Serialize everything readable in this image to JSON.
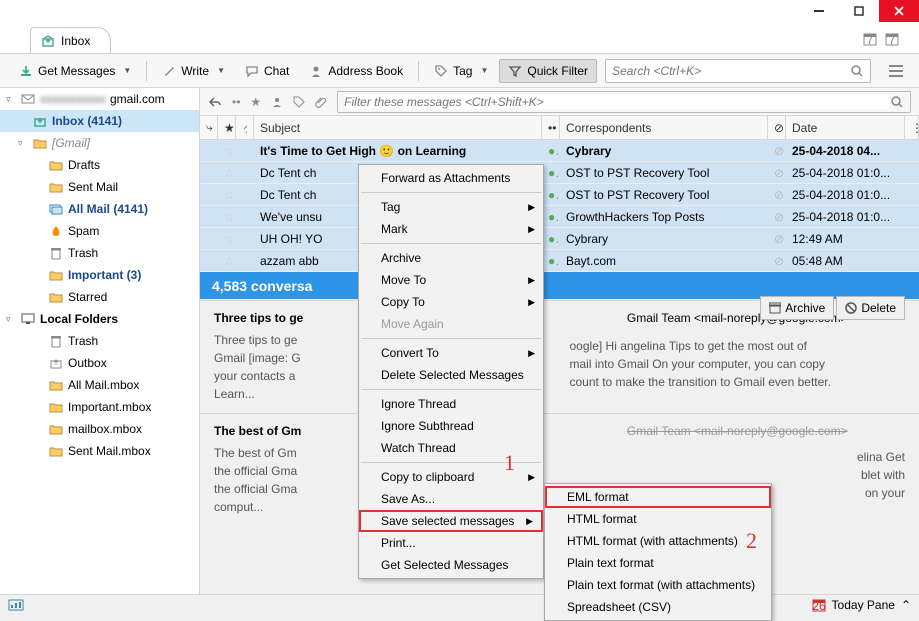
{
  "window": {
    "tab_label": "Inbox"
  },
  "toolbar": {
    "get_messages": "Get Messages",
    "write": "Write",
    "chat": "Chat",
    "address_book": "Address Book",
    "tag": "Tag",
    "quick_filter": "Quick Filter",
    "search_placeholder": "Search <Ctrl+K>"
  },
  "sidebar": {
    "account": "gmail.com",
    "items": [
      {
        "label": "Inbox (4141)",
        "bold": true
      },
      {
        "label": "[Gmail]",
        "gray": true
      },
      {
        "label": "Drafts"
      },
      {
        "label": "Sent Mail"
      },
      {
        "label": "All Mail (4141)",
        "bold": true
      },
      {
        "label": "Spam"
      },
      {
        "label": "Trash"
      },
      {
        "label": "Important (3)",
        "bold": true
      },
      {
        "label": "Starred"
      }
    ],
    "local_header": "Local Folders",
    "local": [
      {
        "label": "Trash"
      },
      {
        "label": "Outbox"
      },
      {
        "label": "All Mail.mbox"
      },
      {
        "label": "Important.mbox"
      },
      {
        "label": "mailbox.mbox"
      },
      {
        "label": "Sent Mail.mbox"
      }
    ]
  },
  "filter": {
    "placeholder": "Filter these messages <Ctrl+Shift+K>"
  },
  "columns": {
    "subject": "Subject",
    "correspondents": "Correspondents",
    "date": "Date"
  },
  "messages": [
    {
      "subject": "It's Time to Get High 🙂 on Learning",
      "from": "Cybrary",
      "date": "25-04-2018 04...",
      "bold": true
    },
    {
      "subject": "Dc Tent ch",
      "from": "OST to PST Recovery Tool",
      "date": "25-04-2018 01:0..."
    },
    {
      "subject": "Dc Tent ch",
      "from": "OST to PST Recovery Tool",
      "date": "25-04-2018 01:0..."
    },
    {
      "subject": "We've unsu",
      "from": "GrowthHackers Top Posts",
      "date": "25-04-2018 01:0..."
    },
    {
      "subject": "UH OH! YO",
      "from": "Cybrary",
      "date": "12:49 AM"
    },
    {
      "subject": "azzam abb",
      "from": "Bayt.com",
      "date": "05:48 AM"
    }
  ],
  "conversation_banner": "4,583 conversa",
  "preview": {
    "left_title": "Three tips to ge",
    "left_body": "Three tips to ge\nGmail [image: G\nyour contacts a\nLearn...",
    "sender": "Gmail Team <mail-noreply@google.com>",
    "right_body": "oogle] Hi angelina Tips to get the most out of\nmail into Gmail On your computer, you can copy\ncount to make the transition to Gmail even better.",
    "second_title": "The best of Gm",
    "second_body": "The best of Gm\nthe official Gma\nthe official Gma\ncomput...",
    "second_sender_partial": "Gmail Team <mail-noreply@google.com>",
    "second_right": "elina Get\nblet with\non your",
    "archive": "Archive",
    "delete": "Delete"
  },
  "ctx1": {
    "items": [
      "Forward as Attachments",
      "—",
      "Tag",
      "Mark",
      "—",
      "Archive",
      "Move To",
      "Copy To",
      "Move Again",
      "—",
      "Convert To",
      "Delete Selected Messages",
      "—",
      "Ignore Thread",
      "Ignore Subthread",
      "Watch Thread",
      "—",
      "Copy to clipboard",
      "Save As...",
      "Save selected messages",
      "Print...",
      "Get Selected Messages"
    ],
    "highlight_index": 19,
    "annotation_1": "1"
  },
  "ctx2": {
    "items": [
      "EML format",
      "HTML format",
      "HTML format (with attachments)",
      "Plain text format",
      "Plain text format (with attachments)",
      "Spreadsheet (CSV)"
    ],
    "annotation_2": "2"
  },
  "status": {
    "today_pane": "Today Pane"
  }
}
